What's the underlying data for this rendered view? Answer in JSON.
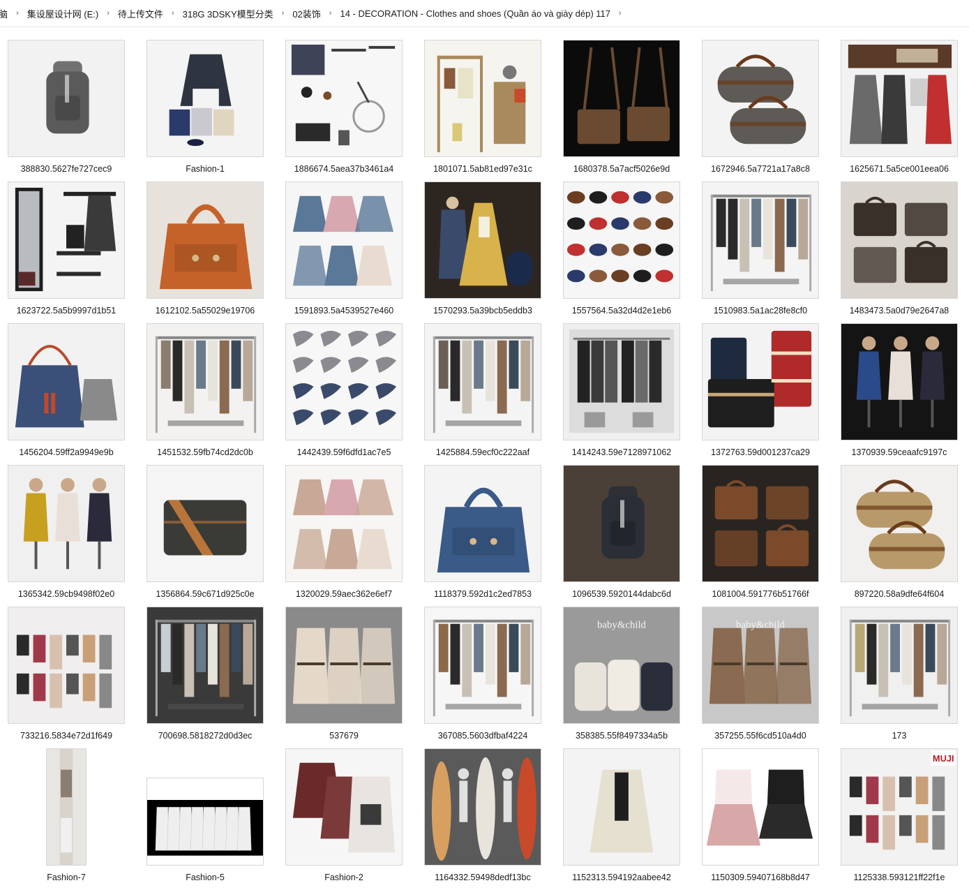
{
  "breadcrumb": [
    "脑",
    "集设屋设计网 (E:)",
    "待上传文件",
    "318G 3DSKY模型分类",
    "02装饰",
    "14 - DECORATION - Clothes and shoes (Quần áo và giày dép) 117"
  ],
  "items": [
    {
      "name": "388830.5627fe727cec9",
      "bg": "#f2f2f2",
      "fg": "#5a5a5a",
      "kind": "backpack"
    },
    {
      "name": "Fashion-1",
      "bg": "#f4f4f4",
      "fg": "#2e3440",
      "kind": "jacket"
    },
    {
      "name": "1886674.5aea37b3461a4",
      "bg": "#f7f7f7",
      "fg": "#3a3a3a",
      "kind": "misc"
    },
    {
      "name": "1801071.5ab81ed97e31c",
      "bg": "#f6f4ef",
      "fg": "#a98a5c",
      "kind": "rack"
    },
    {
      "name": "1680378.5a7acf5026e9d",
      "bg": "#0b0b0b",
      "fg": "#6a4a30",
      "kind": "bags"
    },
    {
      "name": "1672946.5a7721a17a8c8",
      "bg": "#f3f3f3",
      "fg": "#5e5a55",
      "kind": "duffel"
    },
    {
      "name": "1625671.5a5ce001eea06",
      "bg": "#f2f2f2",
      "fg": "#5a3a28",
      "kind": "coats"
    },
    {
      "name": "1623722.5a5b9997d1b51",
      "bg": "#f4f4f4",
      "fg": "#2a2a2a",
      "kind": "mirror"
    },
    {
      "name": "1612102.5a55029e19706",
      "bg": "#e8e2dc",
      "fg": "#c4622a",
      "kind": "tote"
    },
    {
      "name": "1591893.5a4539527e460",
      "bg": "#f6f6f6",
      "fg": "#5a7898",
      "kind": "dresses"
    },
    {
      "name": "1570293.5a39bcb5eddb3",
      "bg": "#2d2620",
      "fg": "#d8b24a",
      "kind": "costume"
    },
    {
      "name": "1557564.5a32d4d2e1eb6",
      "bg": "#f6f6f6",
      "fg": "#6a3e22",
      "kind": "shoes"
    },
    {
      "name": "1510983.5a1ac28fe8cf0",
      "bg": "#f4f4f4",
      "fg": "#2a2a2a",
      "kind": "clothesrack"
    },
    {
      "name": "1483473.5a0d79e2647a8",
      "bg": "#d9d4cd",
      "fg": "#3a302a",
      "kind": "briefcases"
    },
    {
      "name": "1456204.59ff2a9949e9b",
      "bg": "#f2f2f2",
      "fg": "#3a5078",
      "kind": "bucketbag"
    },
    {
      "name": "1451532.59fb74cd2dc0b",
      "bg": "#f3f2f0",
      "fg": "#8a7e70",
      "kind": "clothesrack"
    },
    {
      "name": "1442439.59f6dfd1ac7e5",
      "bg": "#f7f7f7",
      "fg": "#3a4a6a",
      "kind": "scarves"
    },
    {
      "name": "1425884.59ecf0c222aaf",
      "bg": "#f4f4f4",
      "fg": "#6a6058",
      "kind": "clothesrack"
    },
    {
      "name": "1414243.59e7128971062",
      "bg": "#efefef",
      "fg": "#2a2a2a",
      "kind": "wardrobe"
    },
    {
      "name": "1372763.59d001237ca29",
      "bg": "#f3f3f3",
      "fg": "#b02a2a",
      "kind": "suitcases"
    },
    {
      "name": "1370939.59ceaafc9197c",
      "bg": "#141414",
      "fg": "#2a4a8a",
      "kind": "mannequins"
    },
    {
      "name": "1365342.59cb9498f02e0",
      "bg": "#f0f0f0",
      "fg": "#c8a020",
      "kind": "mannequins"
    },
    {
      "name": "1356864.59c671d925c0e",
      "bg": "#f5f5f5",
      "fg": "#3a3a36",
      "kind": "messenger"
    },
    {
      "name": "1320029.59aec362e6ef7",
      "bg": "#f7f6f4",
      "fg": "#c8a896",
      "kind": "dresses"
    },
    {
      "name": "1118379.592d1c2ed7853",
      "bg": "#f4f4f4",
      "fg": "#3a5a88",
      "kind": "tote"
    },
    {
      "name": "1096539.5920144dabc6d",
      "bg": "#4a4038",
      "fg": "#2a2e36",
      "kind": "backpack"
    },
    {
      "name": "1081004.591776b51766f",
      "bg": "#2a2420",
      "fg": "#7a4a2a",
      "kind": "briefcases"
    },
    {
      "name": "897220.58a9dfe64f604",
      "bg": "#f2f0ee",
      "fg": "#b89a6a",
      "kind": "duffel"
    },
    {
      "name": "733216.5834e72d1f649",
      "bg": "#f0eeee",
      "fg": "#a03a4a",
      "kind": "cosmetics"
    },
    {
      "name": "700698.5818272d0d3ec",
      "bg": "#3a3a3a",
      "fg": "#c8cfd4",
      "kind": "clothesrack"
    },
    {
      "name": "537679",
      "bg": "#8a8a8a",
      "fg": "#e4d8c8",
      "kind": "robes"
    },
    {
      "name": "367085.5603dfbaf4224",
      "bg": "#f6f6f6",
      "fg": "#8a6a4a",
      "kind": "clothesrack"
    },
    {
      "name": "358385.55f8497334a5b",
      "bg": "#9a9a9a",
      "fg": "#e8e4dc",
      "kind": "baskets",
      "text": "baby&child"
    },
    {
      "name": "357255.55f6cd510a4d0",
      "bg": "#c8c8c8",
      "fg": "#8a6a50",
      "kind": "robes",
      "text": "baby&child"
    },
    {
      "name": "173",
      "bg": "#f0f0f0",
      "fg": "#b8a878",
      "kind": "clothesrack"
    },
    {
      "name": "Fashion-7",
      "bg": "#e8e6e2",
      "fg": "#6a5a4a",
      "kind": "narrow"
    },
    {
      "name": "Fashion-5",
      "bg": "#000000",
      "fg": "#eeeeee",
      "kind": "shirts"
    },
    {
      "name": "Fashion-2",
      "bg": "#f6f6f6",
      "fg": "#6a2a2a",
      "kind": "sweaters"
    },
    {
      "name": "1164332.59498dedf13bc",
      "bg": "#5a5a5a",
      "fg": "#d8a060",
      "kind": "surf"
    },
    {
      "name": "1152313.594192aabee42",
      "bg": "#f3f3f3",
      "fg": "#e6e0d0",
      "kind": "cardigan"
    },
    {
      "name": "1150309.59407168b8d47",
      "bg": "#ffffff",
      "fg": "#d8a8a8",
      "kind": "kids"
    },
    {
      "name": "1125338.593121ff22f1e",
      "bg": "#f2f2f2",
      "fg": "#2a2a2a",
      "kind": "cosmetics",
      "text": "MUJI"
    }
  ]
}
